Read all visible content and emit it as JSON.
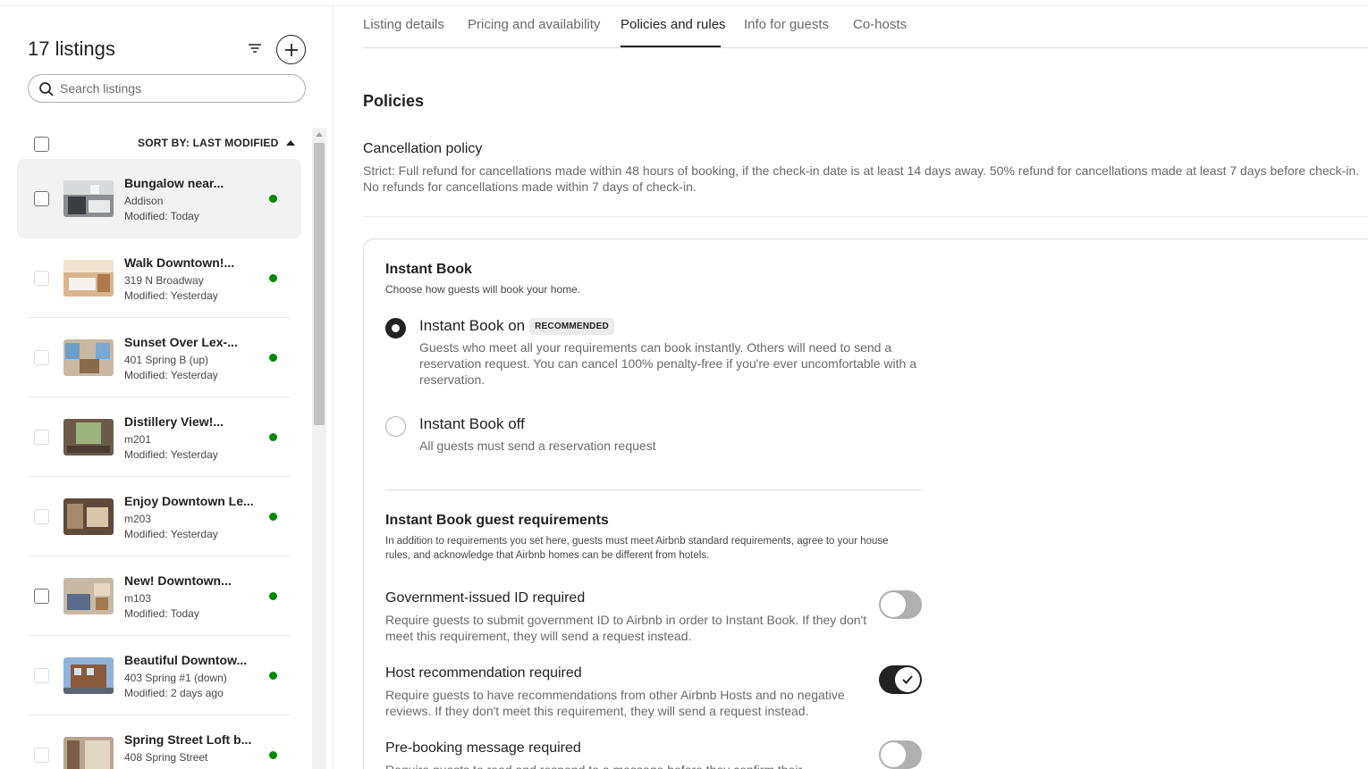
{
  "sidebar": {
    "title": "17 listings",
    "search_placeholder": "Search listings",
    "sort_label": "SORT BY: LAST MODIFIED",
    "listings": [
      {
        "name": "Bungalow near...",
        "address": "Addison",
        "modified": "Modified: Today"
      },
      {
        "name": "Walk Downtown!...",
        "address": "319 N Broadway",
        "modified": "Modified: Yesterday"
      },
      {
        "name": "Sunset Over Lex-...",
        "address": "401 Spring B (up)",
        "modified": "Modified: Yesterday"
      },
      {
        "name": "Distillery View!...",
        "address": "m201",
        "modified": "Modified: Yesterday"
      },
      {
        "name": "Enjoy Downtown Le...",
        "address": "m203",
        "modified": "Modified: Yesterday"
      },
      {
        "name": "New! Downtown...",
        "address": "m103",
        "modified": "Modified: Today"
      },
      {
        "name": "Beautiful Downtow...",
        "address": "403 Spring #1 (down)",
        "modified": "Modified: 2 days ago"
      },
      {
        "name": "Spring Street Loft b...",
        "address": "408 Spring Street",
        "modified": ""
      }
    ]
  },
  "tabs": [
    {
      "label": "Listing details"
    },
    {
      "label": "Pricing and availability"
    },
    {
      "label": "Policies and rules"
    },
    {
      "label": "Info for guests"
    },
    {
      "label": "Co-hosts"
    }
  ],
  "policies": {
    "heading": "Policies",
    "cancellation_title": "Cancellation policy",
    "cancellation_text": "Strict: Full refund for cancellations made within 48 hours of booking, if the check-in date is at least 14 days away. 50% refund for cancellations made at least 7 days before check-in. No refunds for cancellations made within 7 days of check-in."
  },
  "instant_book": {
    "title": "Instant Book",
    "subtitle": "Choose how guests will book your home.",
    "on": {
      "label": "Instant Book on",
      "badge": "RECOMMENDED",
      "description": "Guests who meet all your requirements can book instantly. Others will need to send a reservation request. You can cancel 100% penalty-free if you're ever uncomfortable with a reservation."
    },
    "off": {
      "label": "Instant Book off",
      "description": "All guests must send a reservation request"
    }
  },
  "requirements": {
    "title": "Instant Book guest requirements",
    "subtitle": "In addition to requirements you set here, guests must meet Airbnb standard requirements, agree to your house rules, and acknowledge that Airbnb homes can be different from hotels.",
    "items": [
      {
        "name": "Government-issued ID required",
        "description": "Require guests to submit government ID to Airbnb in order to Instant Book. If they don't meet this requirement, they will send a request instead."
      },
      {
        "name": "Host recommendation required",
        "description": "Require guests to have recommendations from other Airbnb Hosts and no negative reviews. If they don't meet this requirement, they will send a request instead."
      },
      {
        "name": "Pre-booking message required",
        "description": "Require guests to read and respond to a message before they confirm their reservation."
      }
    ]
  },
  "colors": {
    "status_active": "#008a05",
    "text_primary": "#222222",
    "text_secondary": "#6a6a6a"
  }
}
